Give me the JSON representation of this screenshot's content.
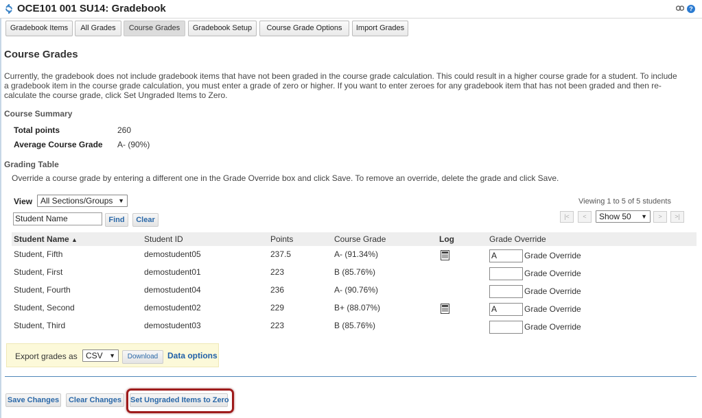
{
  "window": {
    "title": "OCE101 001 SU14: Gradebook"
  },
  "toolbar": {
    "tabs": [
      {
        "label": "Gradebook Items"
      },
      {
        "label": "All Grades"
      },
      {
        "label": "Course Grades",
        "active": true
      },
      {
        "label": "Gradebook Setup"
      },
      {
        "label": "Course Grade Options"
      },
      {
        "label": "Import Grades"
      }
    ]
  },
  "page": {
    "heading": "Course Grades",
    "intro_line1": "Currently, the gradebook does not include gradebook items that have not been graded in the course grade calculation. This could result in a higher course grade for a student. To include",
    "intro_line2": "a gradebook item in the course grade calculation, you must enter a grade of zero or higher. If you want to enter zeroes for any gradebook item that has not been graded and then re-",
    "intro_line3": "calculate the course grade, click Set Ungraded Items to Zero."
  },
  "summary": {
    "heading": "Course Summary",
    "total_points_label": "Total points",
    "total_points_value": "260",
    "avg_label": "Average Course Grade",
    "avg_value": "A- (90%)"
  },
  "grading": {
    "heading": "Grading Table",
    "instructions": "Override a course grade by entering a different one in the Grade Override box and click Save. To remove an override, delete the grade and click Save.",
    "view_label": "View",
    "view_selected": "All Sections/Groups",
    "search_value": "Student Name",
    "find_label": "Find",
    "clear_label": "Clear",
    "viewing_text": "Viewing 1 to 5 of 5 students",
    "pager": {
      "first": "|<",
      "prev": "<",
      "show": "Show 50",
      "next": ">",
      "last": ">|"
    }
  },
  "table": {
    "columns": [
      "Student Name",
      "Student ID",
      "Points",
      "Course Grade",
      "Log",
      "Grade Override"
    ],
    "sort_indicator": "▲",
    "override_label": "Grade Override",
    "rows": [
      {
        "name": "Student, Fifth",
        "id": "demostudent05",
        "points": "237.5",
        "grade": "A- (91.34%)",
        "log": true,
        "override": "A"
      },
      {
        "name": "Student, First",
        "id": "demostudent01",
        "points": "223",
        "grade": "B (85.76%)",
        "log": false,
        "override": ""
      },
      {
        "name": "Student, Fourth",
        "id": "demostudent04",
        "points": "236",
        "grade": "A- (90.76%)",
        "log": false,
        "override": ""
      },
      {
        "name": "Student, Second",
        "id": "demostudent02",
        "points": "229",
        "grade": "B+ (88.07%)",
        "log": true,
        "override": "A"
      },
      {
        "name": "Student, Third",
        "id": "demostudent03",
        "points": "223",
        "grade": "B (85.76%)",
        "log": false,
        "override": ""
      }
    ]
  },
  "export": {
    "label": "Export grades as",
    "format": "CSV",
    "download_label": "Download",
    "data_options_label": "Data options"
  },
  "actions": {
    "save": "Save Changes",
    "clear": "Clear Changes",
    "zero": "Set Ungraded Items to Zero"
  }
}
